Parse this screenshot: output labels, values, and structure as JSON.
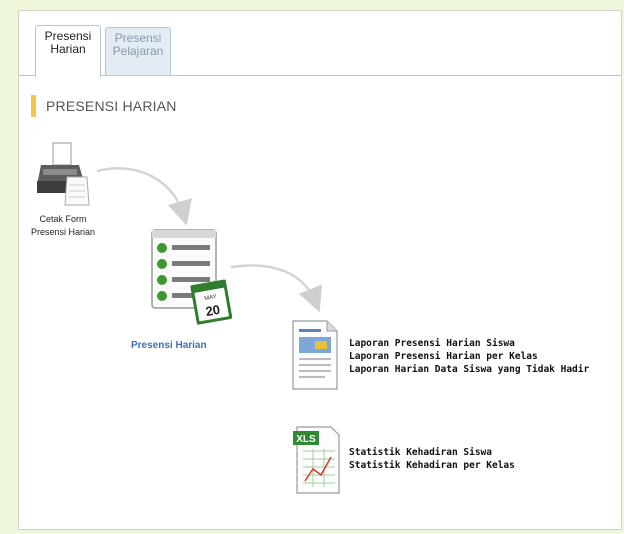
{
  "tabs": [
    {
      "line1": "Presensi",
      "line2": "Harian",
      "active": true
    },
    {
      "line1": "Presensi",
      "line2": "Pelajaran",
      "active": false
    }
  ],
  "section_title": "PRESENSI HARIAN",
  "steps": {
    "print_form_label_line1": "Cetak Form",
    "print_form_label_line2": "Presensi Harian",
    "presensi_harian_label": "Presensi Harian",
    "calendar_month": "MAY",
    "calendar_day": "20",
    "xls_badge": "XLS"
  },
  "reports": [
    "Laporan Presensi Harian Siswa",
    "Laporan Presensi Harian per Kelas",
    "Laporan Harian Data Siswa yang Tidak Hadir"
  ],
  "statistics": [
    "Statistik Kehadiran Siswa",
    "Statistik Kehadiran per Kelas"
  ],
  "colors": {
    "accent_bar": "#f5c542",
    "link_blue": "#3f70b4",
    "check_green": "#3a9a2c",
    "xls_green": "#2f8a32"
  }
}
